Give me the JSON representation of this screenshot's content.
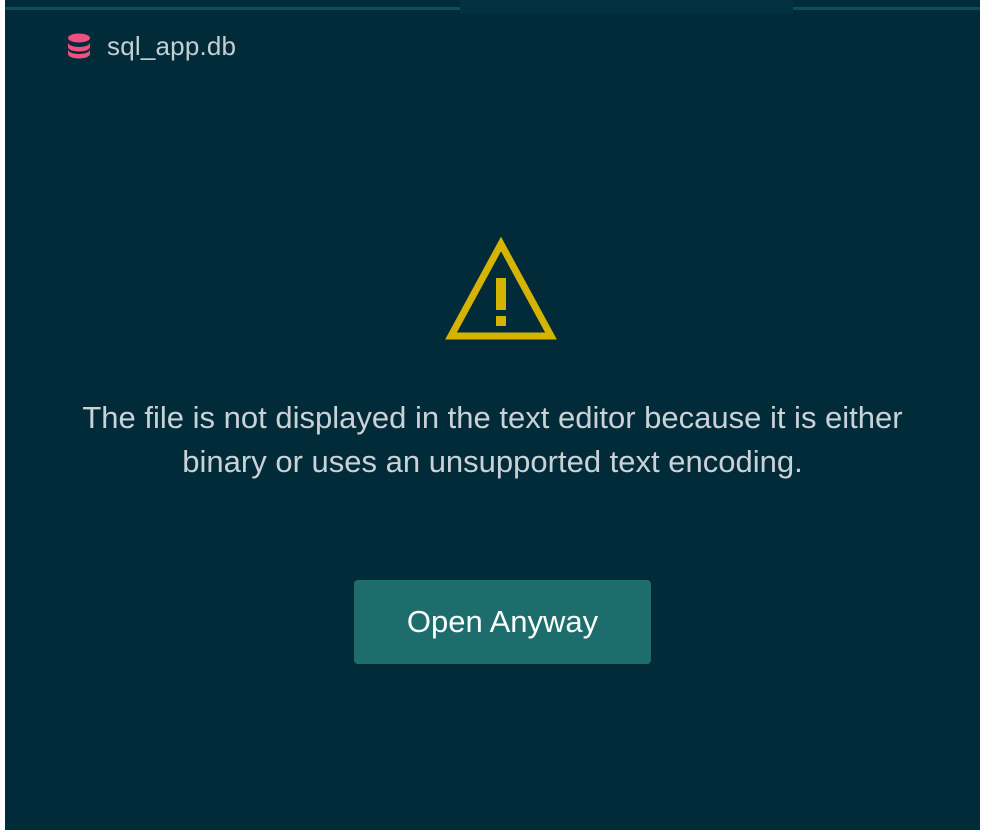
{
  "tab": {
    "title": "sql_app.db",
    "icon": "database-icon",
    "icon_color": "#f0507f"
  },
  "notice": {
    "icon": "warning-icon",
    "icon_color": "#d4b400",
    "message": "The file is not displayed in the text editor because it is either binary or uses an unsupported text encoding."
  },
  "actions": {
    "open_anyway_label": "Open Anyway"
  },
  "colors": {
    "background": "#022b3a",
    "button": "#1e6d6d",
    "tab_indicator": "#0f4d5c"
  }
}
